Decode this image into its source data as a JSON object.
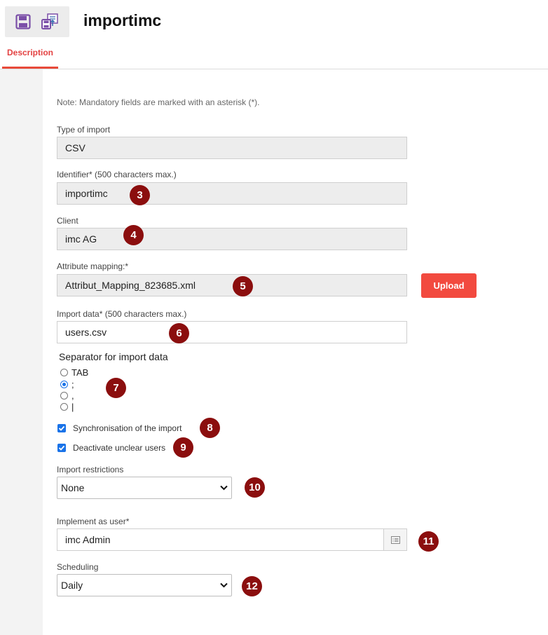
{
  "header": {
    "title": "importimc"
  },
  "toolbar": {
    "save_icon": "save-icon",
    "export_icon": "save-export-icon"
  },
  "tabs": [
    {
      "label": "Description",
      "active": true
    }
  ],
  "form": {
    "note": "Note: Mandatory fields are marked with an asterisk (*).",
    "type_of_import": {
      "label": "Type of import",
      "value": "CSV"
    },
    "identifier": {
      "label": "Identifier* (500 characters max.)",
      "value": "importimc"
    },
    "client": {
      "label": "Client",
      "value": "imc AG"
    },
    "attribute_mapping": {
      "label": "Attribute mapping:*",
      "value": "Attribut_Mapping_823685.xml",
      "upload_label": "Upload"
    },
    "import_data": {
      "label": "Import data* (500 characters max.)",
      "value": "users.csv"
    },
    "separator": {
      "title": "Separator for import data",
      "options": [
        "TAB",
        ";",
        ",",
        "|"
      ],
      "selected": ";"
    },
    "sync_label": "Synchronisation of the import",
    "deactivate_label": "Deactivate unclear users",
    "restrictions": {
      "label": "Import restrictions",
      "value": "None"
    },
    "implement_user": {
      "label": "Implement as user*",
      "value": "imc Admin"
    },
    "scheduling": {
      "label": "Scheduling",
      "value": "Daily"
    }
  },
  "badges": [
    "3",
    "4",
    "5",
    "6",
    "7",
    "8",
    "9",
    "10",
    "11",
    "12"
  ],
  "colors": {
    "accent": "#e84a3a",
    "badge": "#8b0e0e",
    "checkbox": "#1a73e8",
    "icon": "#7b4fa8"
  }
}
